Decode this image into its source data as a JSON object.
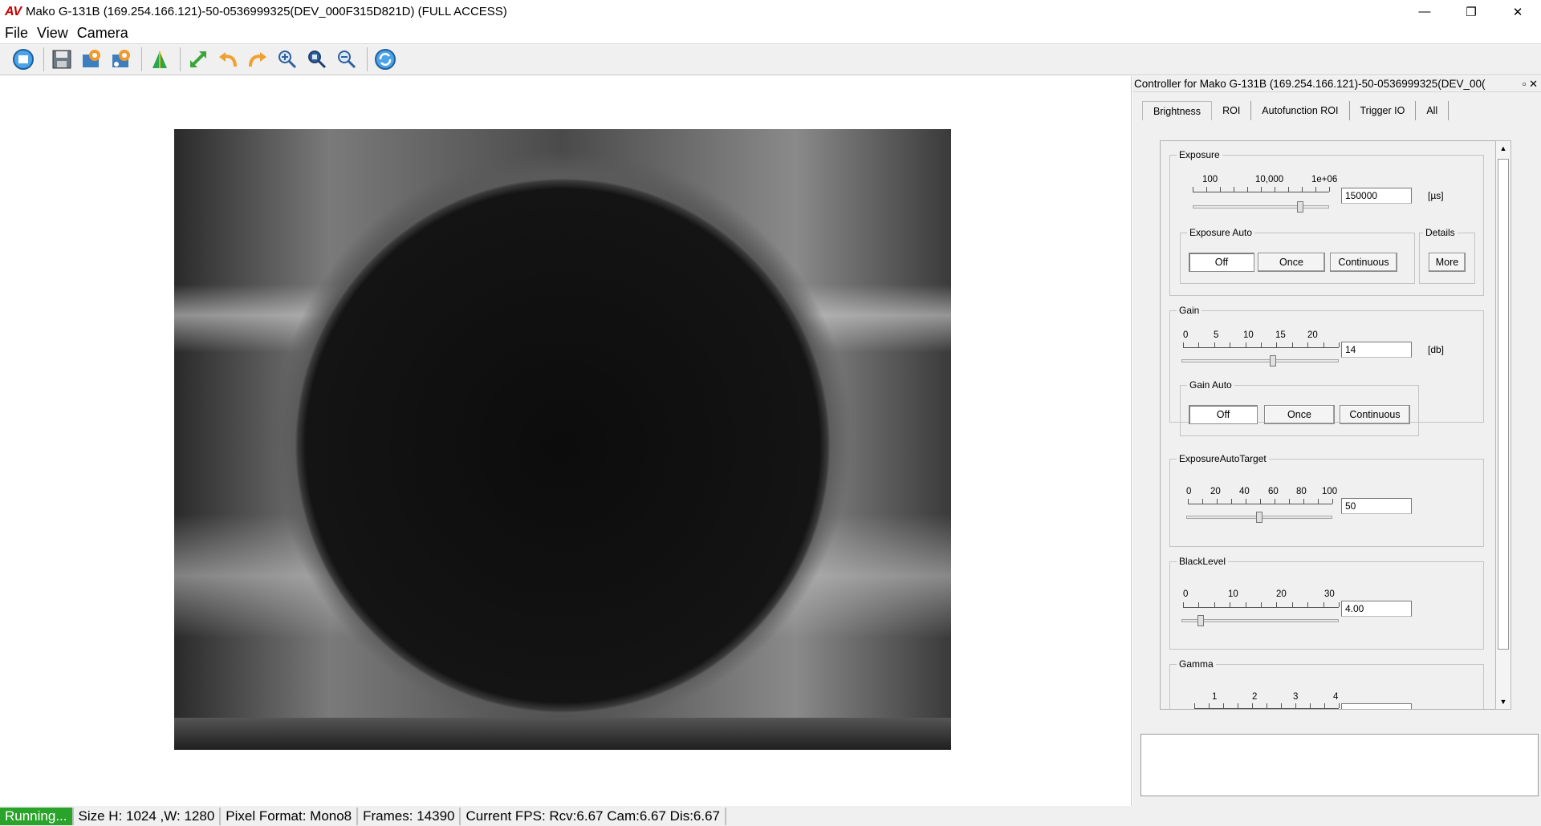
{
  "window": {
    "title": "Mako G-131B (169.254.166.121)-50-0536999325(DEV_000F315D821D) (FULL ACCESS)",
    "logo": "AV",
    "minimize": "—",
    "restore": "❐",
    "close": "✕"
  },
  "menu": {
    "items": [
      "File",
      "View",
      "Camera"
    ]
  },
  "toolbar": {
    "icons": [
      "acquire-icon",
      "save-icon",
      "camera-settings-icon",
      "camera-settings-2-icon",
      "histogram-icon",
      "fit-to-window-icon",
      "rotate-left-icon",
      "rotate-right-icon",
      "zoom-in-icon",
      "zoom-fit-icon",
      "zoom-out-icon",
      "refresh-icon"
    ]
  },
  "controller": {
    "title": "Controller for Mako G-131B (169.254.166.121)-50-0536999325(DEV_00(",
    "header_buttons": "▫ ✕",
    "tabs": [
      "Brightness",
      "ROI",
      "Autofunction ROI",
      "Trigger IO",
      "All"
    ],
    "active_tab": "Brightness",
    "exposure": {
      "title": "Exposure",
      "scale": [
        "100",
        "10,000",
        "1e+06"
      ],
      "value": "150000",
      "unit": "[µs]",
      "level": 0.79
    },
    "exposure_auto": {
      "title": "Exposure Auto",
      "options": [
        "Off",
        "Once",
        "Continuous"
      ],
      "selected": "Off"
    },
    "details": {
      "title": "Details",
      "button": "More"
    },
    "gain": {
      "title": "Gain",
      "scale": [
        "0",
        "5",
        "10",
        "15",
        "20"
      ],
      "value": "14",
      "unit": "[db]",
      "level": 0.58
    },
    "gain_auto": {
      "title": "Gain Auto",
      "options": [
        "Off",
        "Once",
        "Continuous"
      ],
      "selected": "Off"
    },
    "exposure_auto_target": {
      "title": "ExposureAutoTarget",
      "scale": [
        "0",
        "20",
        "40",
        "60",
        "80",
        "100"
      ],
      "value": "50",
      "level": 0.5
    },
    "black_level": {
      "title": "BlackLevel",
      "scale": [
        "0",
        "10",
        "20",
        "30"
      ],
      "value": "4.00",
      "level": 0.12
    },
    "gamma": {
      "title": "Gamma",
      "scale": [
        "1",
        "2",
        "3",
        "4"
      ]
    },
    "scroll_up": "▲",
    "scroll_down": "▼"
  },
  "status": {
    "state": "Running...",
    "size": "Size H: 1024 ,W: 1280",
    "pixel_format": "Pixel Format: Mono8",
    "frames": "Frames: 14390",
    "fps": "Current FPS: Rcv:6.67 Cam:6.67 Dis:6.67"
  }
}
